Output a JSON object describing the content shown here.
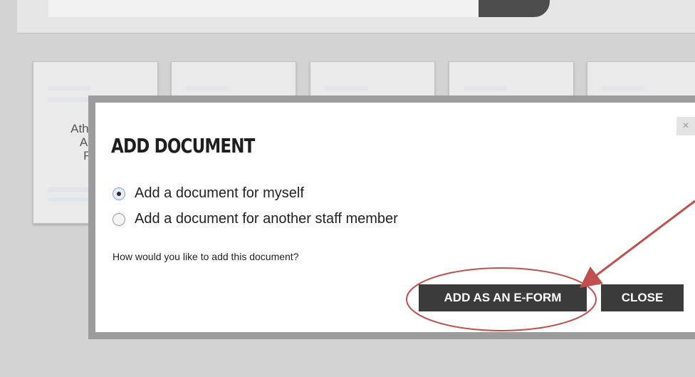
{
  "card": {
    "title_lines": [
      "Athletic",
      "App",
      "Fo"
    ]
  },
  "modal": {
    "title": "ADD DOCUMENT",
    "close_icon": "×",
    "options": [
      {
        "label": "Add a document for myself",
        "selected": true
      },
      {
        "label": "Add a document for another staff member",
        "selected": false
      }
    ],
    "question": "How would you like to add this document?",
    "buttons": {
      "eform": "ADD AS AN E-FORM",
      "close": "CLOSE"
    }
  },
  "annotation": {
    "color": "#c0504d",
    "shapes": [
      "ellipse",
      "arrow"
    ]
  }
}
